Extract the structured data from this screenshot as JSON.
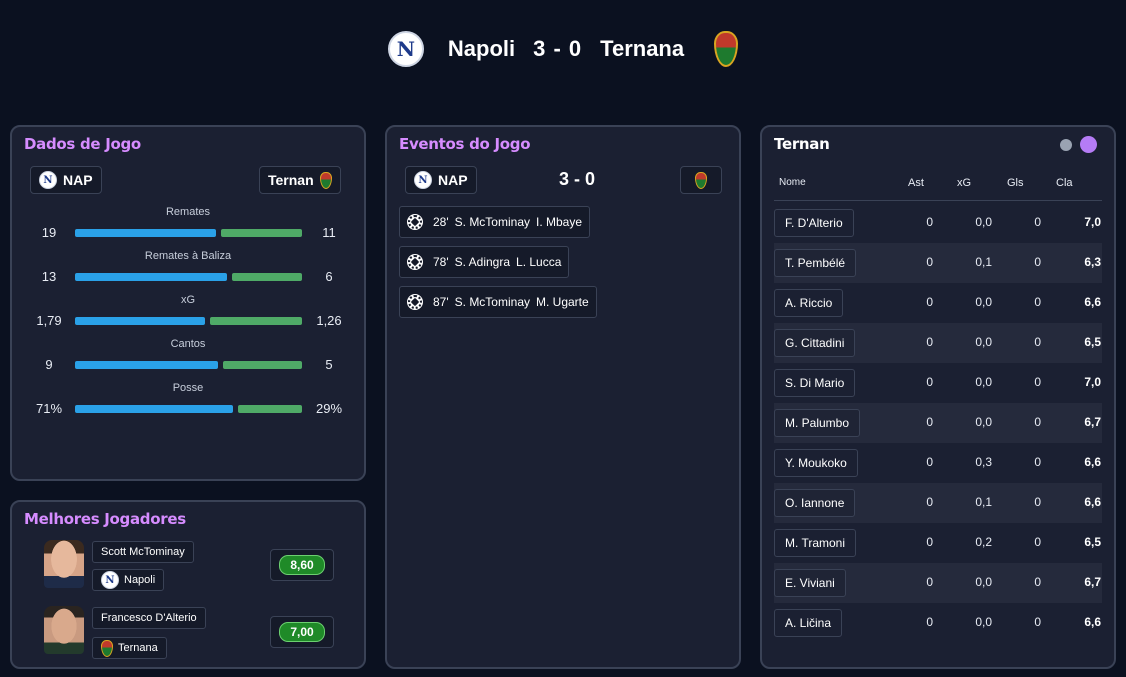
{
  "header": {
    "home_team": "Napoli",
    "score": "3 - 0",
    "away_team": "Ternana",
    "home_crest_letter": "N"
  },
  "dados": {
    "title": "Dados de Jogo",
    "home_chip": "NAP",
    "away_chip": "Ternan",
    "stats": [
      {
        "label": "Remates",
        "home": "19",
        "away": "11",
        "home_share": 0.633
      },
      {
        "label": "Remates à Baliza",
        "home": "13",
        "away": "6",
        "home_share": 0.684
      },
      {
        "label": "xG",
        "home": "1,79",
        "away": "1,26",
        "home_share": 0.587
      },
      {
        "label": "Cantos",
        "home": "9",
        "away": "5",
        "home_share": 0.643
      },
      {
        "label": "Posse",
        "home": "71%",
        "away": "29%",
        "home_share": 0.71
      }
    ]
  },
  "melhores": {
    "title": "Melhores Jogadores",
    "players": [
      {
        "name": "Scott McTominay",
        "team": "Napoli",
        "rating": "8,60"
      },
      {
        "name": "Francesco D'Alterio",
        "team": "Ternana",
        "rating": "7,00"
      }
    ]
  },
  "eventos": {
    "title": "Eventos do Jogo",
    "home_chip": "NAP",
    "score": "3 - 0",
    "events": [
      {
        "minute": "28'",
        "scorer": "S. McTominay",
        "assist": "I. Mbaye",
        "icon": "football-icon"
      },
      {
        "minute": "78'",
        "scorer": "S. Adingra",
        "assist": "L. Lucca",
        "icon": "football-icon"
      },
      {
        "minute": "87'",
        "scorer": "S. McTominay",
        "assist": "M. Ugarte",
        "icon": "football-icon"
      }
    ]
  },
  "ternan": {
    "title": "Ternan",
    "columns": [
      "Nome",
      "Ast",
      "xG",
      "Gls",
      "Cla"
    ],
    "rows": [
      {
        "name": "F. D'Alterio",
        "ast": "0",
        "xg": "0,0",
        "gls": "0",
        "cla": "7,0"
      },
      {
        "name": "T. Pembélé",
        "ast": "0",
        "xg": "0,1",
        "gls": "0",
        "cla": "6,3"
      },
      {
        "name": "A. Riccio",
        "ast": "0",
        "xg": "0,0",
        "gls": "0",
        "cla": "6,6"
      },
      {
        "name": "G. Cittadini",
        "ast": "0",
        "xg": "0,0",
        "gls": "0",
        "cla": "6,5"
      },
      {
        "name": "S. Di Mario",
        "ast": "0",
        "xg": "0,0",
        "gls": "0",
        "cla": "7,0"
      },
      {
        "name": "M. Palumbo",
        "ast": "0",
        "xg": "0,0",
        "gls": "0",
        "cla": "6,7"
      },
      {
        "name": "Y. Moukoko",
        "ast": "0",
        "xg": "0,3",
        "gls": "0",
        "cla": "6,6"
      },
      {
        "name": "O. Iannone",
        "ast": "0",
        "xg": "0,1",
        "gls": "0",
        "cla": "6,6"
      },
      {
        "name": "M. Tramoni",
        "ast": "0",
        "xg": "0,2",
        "gls": "0",
        "cla": "6,5"
      },
      {
        "name": "E. Viviani",
        "ast": "0",
        "xg": "0,0",
        "gls": "0",
        "cla": "6,7"
      },
      {
        "name": "A. Ličina",
        "ast": "0",
        "xg": "0,0",
        "gls": "0",
        "cla": "6,6"
      }
    ]
  },
  "colors": {
    "background": "#0b1120",
    "panel": "#1b2032",
    "accent_title": "#d68cff",
    "home_bar": "#2aa1e8",
    "away_bar": "#4faa67",
    "rating_green": "#1f8a28",
    "toggle_inactive": "#9aa3b2",
    "toggle_active": "#b57cf5"
  }
}
